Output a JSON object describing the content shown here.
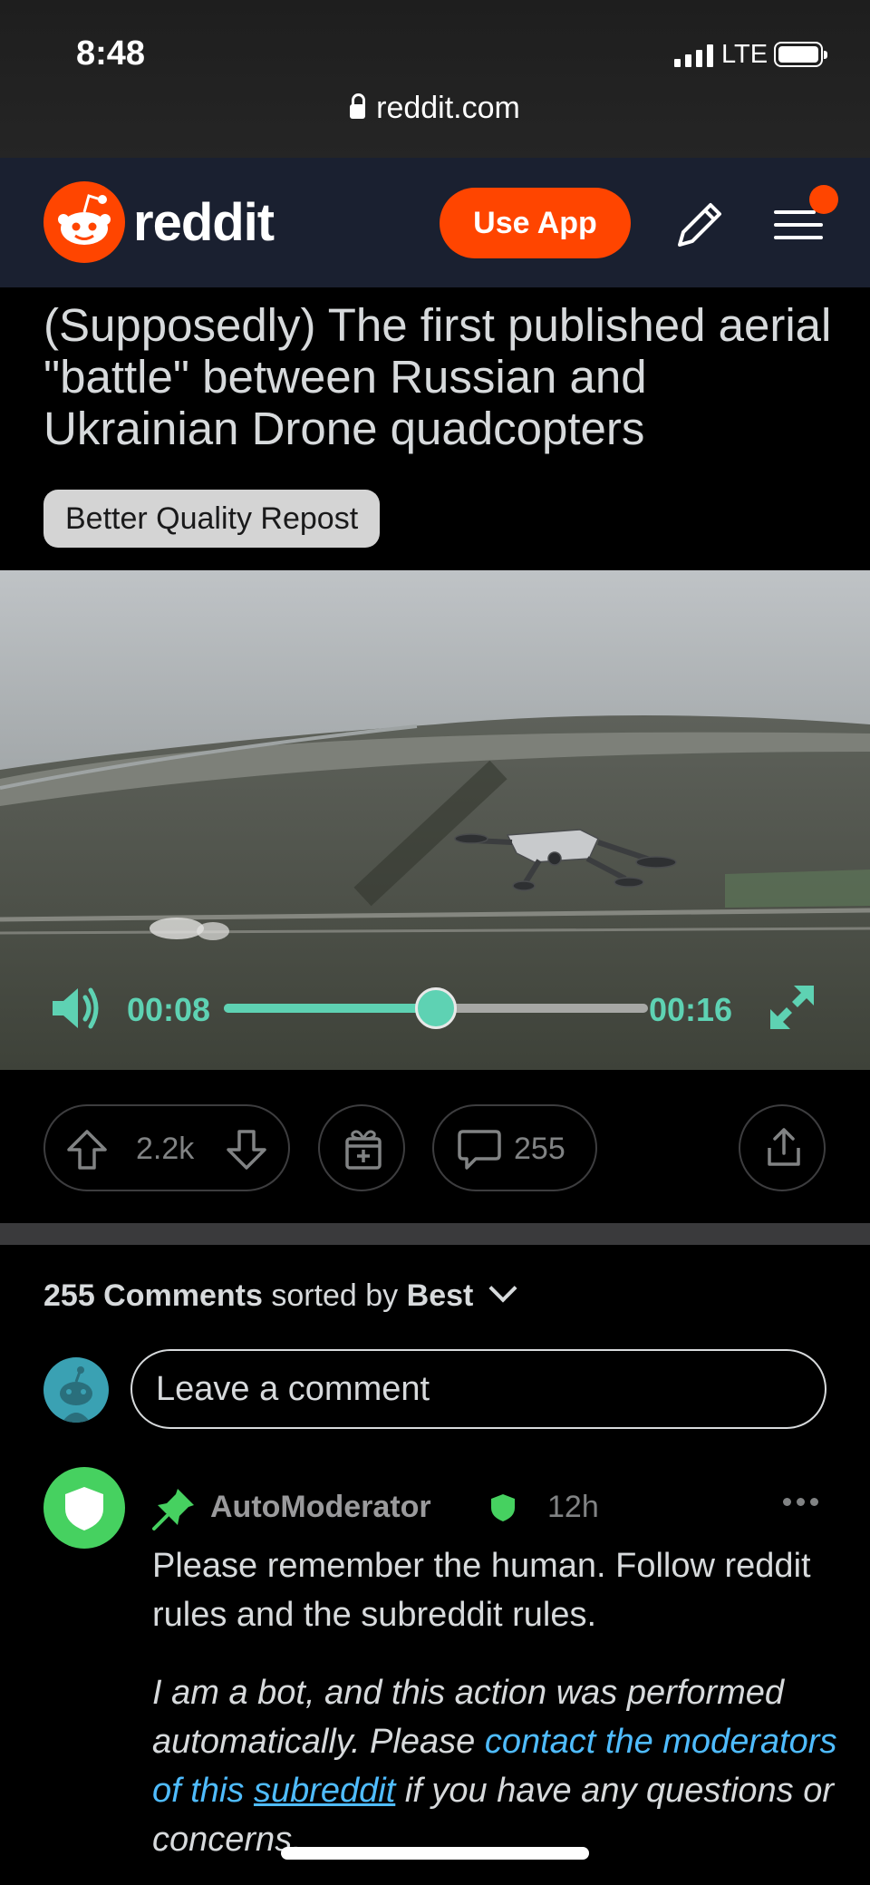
{
  "status": {
    "time": "8:48",
    "network": "LTE"
  },
  "browser": {
    "url": "reddit.com"
  },
  "header": {
    "brand": "reddit",
    "use_app_label": "Use App",
    "icons": [
      "reddit-snoo-icon",
      "pencil-icon",
      "menu-icon"
    ]
  },
  "post": {
    "title": "(Supposedly) The first published aerial \"battle\" between Russian and Ukrainian Drone quadcopters",
    "flair": "Better Quality Repost"
  },
  "video": {
    "current_time": "00:08",
    "duration": "00:16",
    "progress": 0.5
  },
  "actions": {
    "votes": "2.2k",
    "comments": "255"
  },
  "comments_section": {
    "count_label": "255 Comments",
    "sorted_by": "sorted by",
    "sort_value": "Best",
    "placeholder": "Leave a comment"
  },
  "comment": {
    "author": "AutoModerator",
    "age": "12h",
    "body": "Please remember the human. Follow reddit rules and the subreddit rules.",
    "bot_note_1": "I am a bot, and this action was performed automatically. Please ",
    "bot_link_a": "contact the moderators of this ",
    "bot_link_b": "subreddit",
    "bot_note_2": " if you have any questions or concerns."
  },
  "colors": {
    "accent": "#ff4500",
    "player": "#5ed2b3",
    "mod_green": "#46d160",
    "link": "#4fbcff"
  }
}
